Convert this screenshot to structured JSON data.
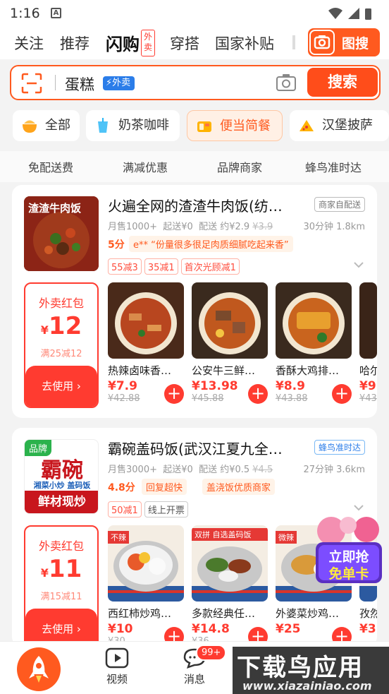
{
  "status": {
    "time": "1:16",
    "a_icon": "A"
  },
  "topnav": {
    "tabs": [
      "关注",
      "推荐",
      "闪购",
      "穿搭",
      "国家补贴"
    ],
    "waimai_tag": "外卖",
    "image_search": "图搜"
  },
  "search": {
    "keyword": "蛋糕",
    "tag": "外卖",
    "button": "搜索"
  },
  "chips": [
    "全部",
    "奶茶咖啡",
    "便当简餐",
    "汉堡披萨"
  ],
  "filters": [
    "免配送费",
    "满减优惠",
    "品牌商家",
    "蜂鸟准时达"
  ],
  "shops": [
    {
      "name": "火遍全网的渣渣牛肉饭(纺…",
      "thumb_text": "渣渣牛肉饭",
      "badge": "商家自配送",
      "monthly": "月售1000+",
      "min_order": "起送¥0",
      "delivery": "配送 约¥2.9",
      "delivery_old": "¥3.9",
      "time_dist": "30分钟 1.8km",
      "score": "5分",
      "quote": "e** “份量很多很足肉质细腻吃起来香”",
      "promos": [
        "55减3",
        "35减1",
        "首次光顾减1"
      ],
      "redpack": {
        "title": "外卖红包",
        "currency": "¥",
        "amount": "12",
        "cond": "满25减12",
        "btn": "去使用 ›"
      },
      "dishes": [
        {
          "name": "热辣卤味香…",
          "price": "¥7.9",
          "old": "¥42.88"
        },
        {
          "name": "公安牛三鲜…",
          "price": "¥13.98",
          "old": "¥45.88"
        },
        {
          "name": "香酥大鸡排…",
          "price": "¥8.9",
          "old": "¥43.88"
        },
        {
          "name": "哈尔…",
          "price": "¥9.",
          "old": "¥43"
        }
      ]
    },
    {
      "name": "霸碗盖码饭(武汉江夏九全…",
      "thumb_brand": "品牌",
      "thumb_big": "霸碗",
      "thumb_sub": "湘菜小炒 盖码饭",
      "thumb_band": "鲜材现炒",
      "badge": "蜂鸟准时达",
      "monthly": "月售3000+",
      "min_order": "起送¥0",
      "delivery": "配送 约¥0.5",
      "delivery_old": "¥4.5",
      "time_dist": "27分钟 3.6km",
      "score": "4.8分",
      "tags": [
        "回复超快",
        "盖浇饭优质商家"
      ],
      "promos": [
        "50减1",
        "线上开票"
      ],
      "redpack": {
        "title": "外卖红包",
        "currency": "¥",
        "amount": "11",
        "cond": "满15减11",
        "btn": "去使用 ›"
      },
      "dishes": [
        {
          "name": "西红柿炒鸡…",
          "price": "¥10",
          "old": "¥30",
          "tag": "不辣"
        },
        {
          "name": "多款经典任…",
          "price": "¥14.8",
          "old": "¥36",
          "tag": "双拼 自选盖码饭"
        },
        {
          "name": "外婆菜炒鸡…",
          "price": "¥25",
          "old": "",
          "tag": "微辣"
        },
        {
          "name": "孜然…",
          "price": "¥3(",
          "old": ""
        }
      ],
      "float_promo": [
        "立即抢",
        "免单卡"
      ]
    }
  ],
  "bottombar": {
    "items": [
      "视频",
      "消息"
    ],
    "badge": "99+"
  },
  "watermark": {
    "line1": "下载鸟应用",
    "line2": "www.xiazainiao.com"
  },
  "colors": {
    "accent": "#ff5a1f",
    "red": "#ff3b30",
    "blue": "#2b7de9"
  }
}
